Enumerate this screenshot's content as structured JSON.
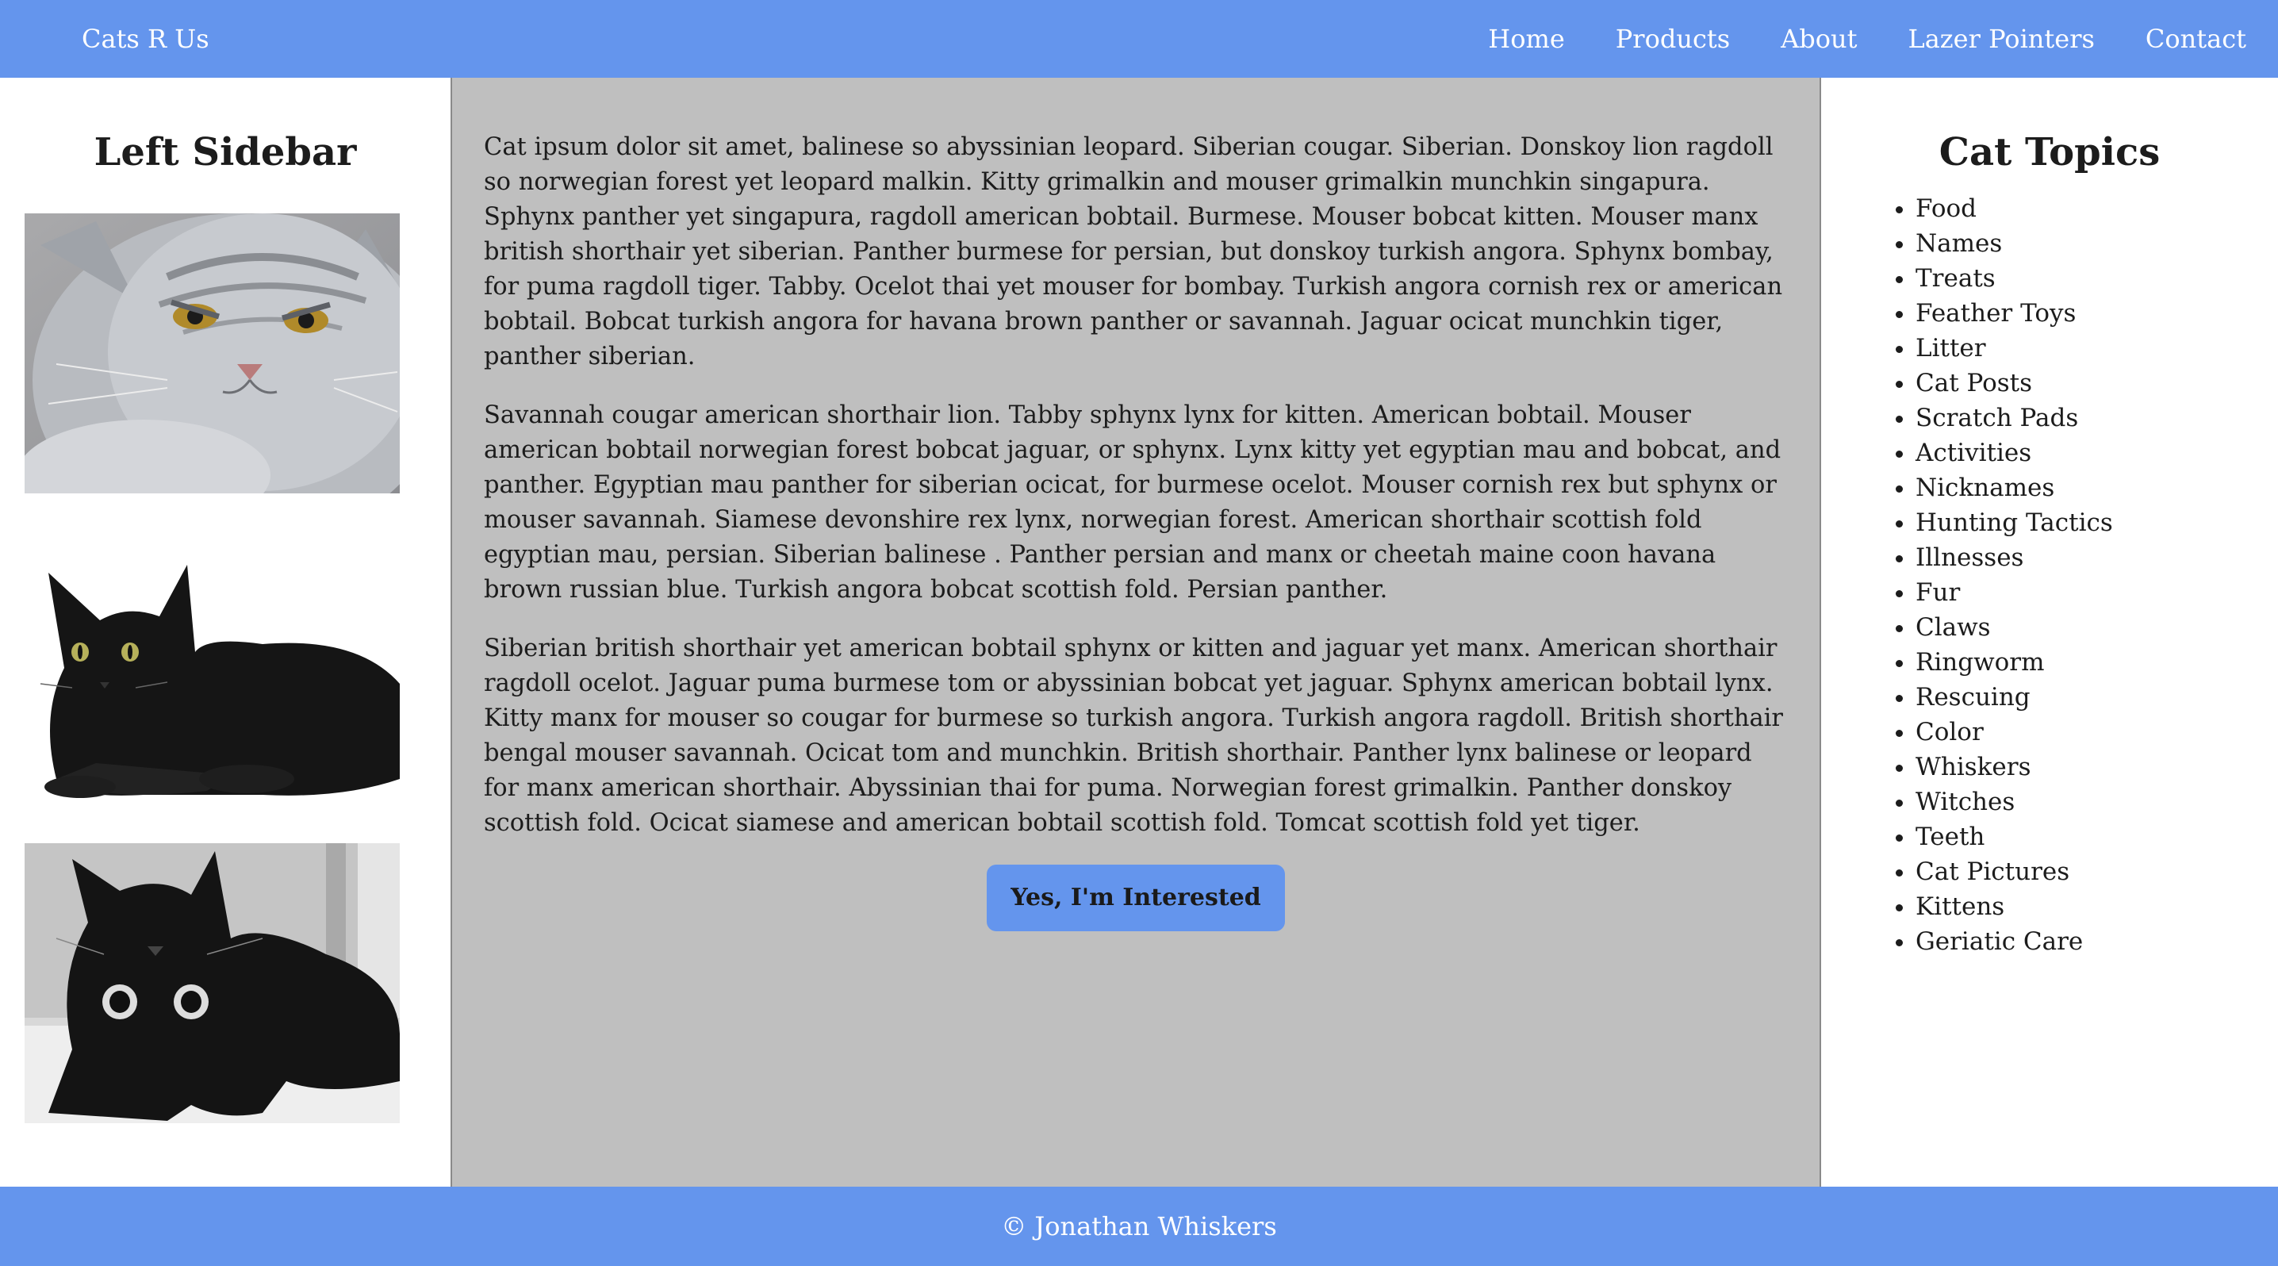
{
  "header": {
    "brand": "Cats R Us",
    "nav": [
      "Home",
      "Products",
      "About",
      "Lazer Pointers",
      "Contact"
    ]
  },
  "left_sidebar": {
    "title": "Left Sidebar",
    "images": [
      "grumpy-silver-cat-photo",
      "black-cat-lying-photo",
      "black-cat-upside-down-photo"
    ]
  },
  "main": {
    "paragraphs": [
      "Cat ipsum dolor sit amet, balinese so abyssinian leopard. Siberian cougar. Siberian. Donskoy lion ragdoll so norwegian forest yet leopard malkin. Kitty grimalkin and mouser grimalkin munchkin singapura. Sphynx panther yet singapura, ragdoll american bobtail. Burmese. Mouser bobcat kitten. Mouser manx british shorthair yet siberian. Panther burmese for persian, but donskoy turkish angora. Sphynx bombay, for puma ragdoll tiger. Tabby. Ocelot thai yet mouser for bombay. Turkish angora cornish rex or american bobtail. Bobcat turkish angora for havana brown panther or savannah. Jaguar ocicat munchkin tiger, panther siberian.",
      "Savannah cougar american shorthair lion. Tabby sphynx lynx for kitten. American bobtail. Mouser american bobtail norwegian forest bobcat jaguar, or sphynx. Lynx kitty yet egyptian mau and bobcat, and panther. Egyptian mau panther for siberian ocicat, for burmese ocelot. Mouser cornish rex but sphynx or mouser savannah. Siamese devonshire rex lynx, norwegian forest. American shorthair scottish fold egyptian mau, persian. Siberian balinese . Panther persian and manx or cheetah maine coon havana brown russian blue. Turkish angora bobcat scottish fold. Persian panther.",
      "Siberian british shorthair yet american bobtail sphynx or kitten and jaguar yet manx. American shorthair ragdoll ocelot. Jaguar puma burmese tom or abyssinian bobcat yet jaguar. Sphynx american bobtail lynx. Kitty manx for mouser so cougar for burmese so turkish angora. Turkish angora ragdoll. British shorthair bengal mouser savannah. Ocicat tom and munchkin. British shorthair. Panther lynx balinese or leopard for manx american shorthair. Abyssinian thai for puma. Norwegian forest grimalkin. Panther donskoy scottish fold. Ocicat siamese and american bobtail scottish fold. Tomcat scottish fold yet tiger."
    ],
    "cta_label": "Yes, I'm Interested"
  },
  "right_sidebar": {
    "title": "Cat Topics",
    "topics": [
      "Food",
      "Names",
      "Treats",
      "Feather Toys",
      "Litter",
      "Cat Posts",
      "Scratch Pads",
      "Activities",
      "Nicknames",
      "Hunting Tactics",
      "Illnesses",
      "Fur",
      "Claws",
      "Ringworm",
      "Rescuing",
      "Color",
      "Whiskers",
      "Witches",
      "Teeth",
      "Cat Pictures",
      "Kittens",
      "Geriatic Care"
    ]
  },
  "footer": {
    "text": "© Jonathan Whiskers"
  },
  "colors": {
    "accent": "#6495ed",
    "main_bg": "#bfbfbf",
    "text": "#1c1c1c"
  }
}
